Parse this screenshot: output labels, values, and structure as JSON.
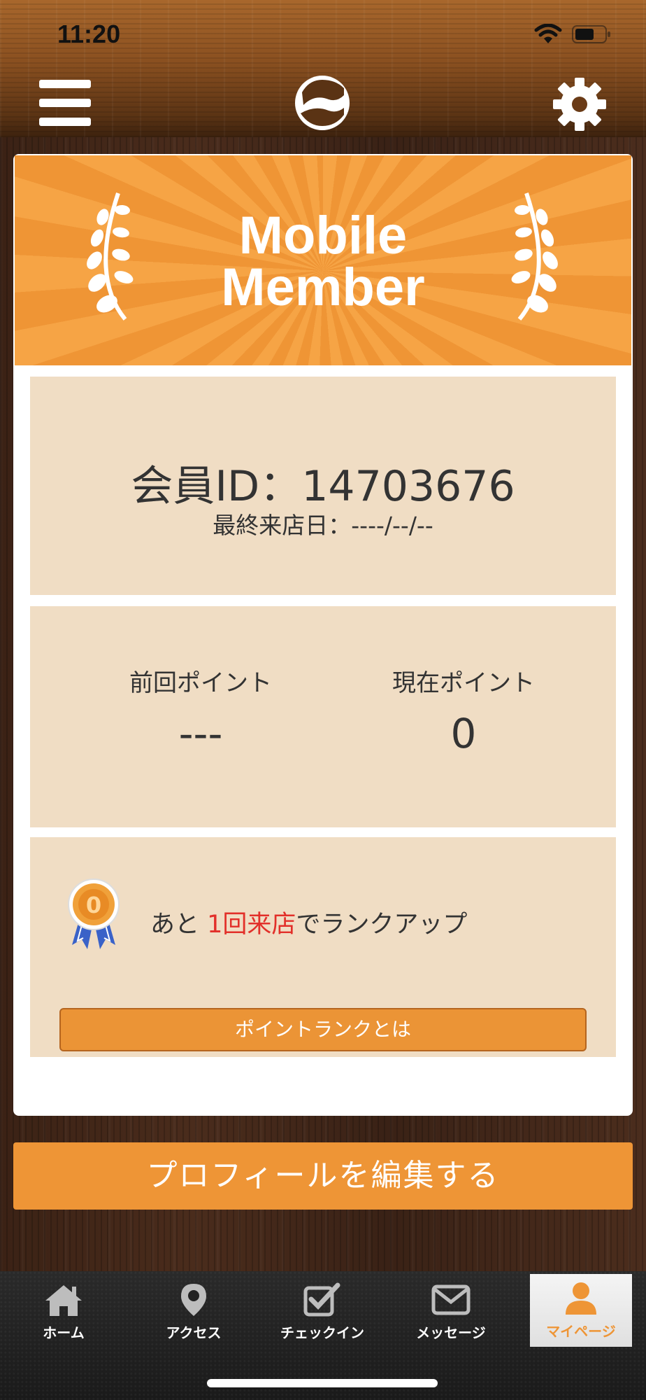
{
  "status_bar": {
    "time": "11:20"
  },
  "header": {
    "menu_icon": "hamburger-menu-icon",
    "logo_icon": "app-logo-icon",
    "settings_icon": "gear-icon"
  },
  "banner": {
    "title_line1": "Mobile",
    "title_line2": "Member"
  },
  "member": {
    "id_text": "会員ID：14703676",
    "last_visit_text": "最終来店日：----/--/--"
  },
  "points": {
    "previous_label": "前回ポイント",
    "previous_value": "---",
    "current_label": "現在ポイント",
    "current_value": "0"
  },
  "rank": {
    "prefix": "あと ",
    "highlight": "1回来店",
    "suffix": "でランクアップ",
    "button_label": "ポイントランクとは",
    "highlight_color": "#e2302a"
  },
  "profile_button": {
    "label": "プロフィールを編集する"
  },
  "tabbar": {
    "home": "ホーム",
    "access": "アクセス",
    "checkin": "チェックイン",
    "message": "メッセージ",
    "mypage": "マイページ",
    "active_color": "#ee9536"
  },
  "colors": {
    "accent": "#ee9536",
    "panel": "#f0ddc4",
    "banner": "#f6a445"
  }
}
